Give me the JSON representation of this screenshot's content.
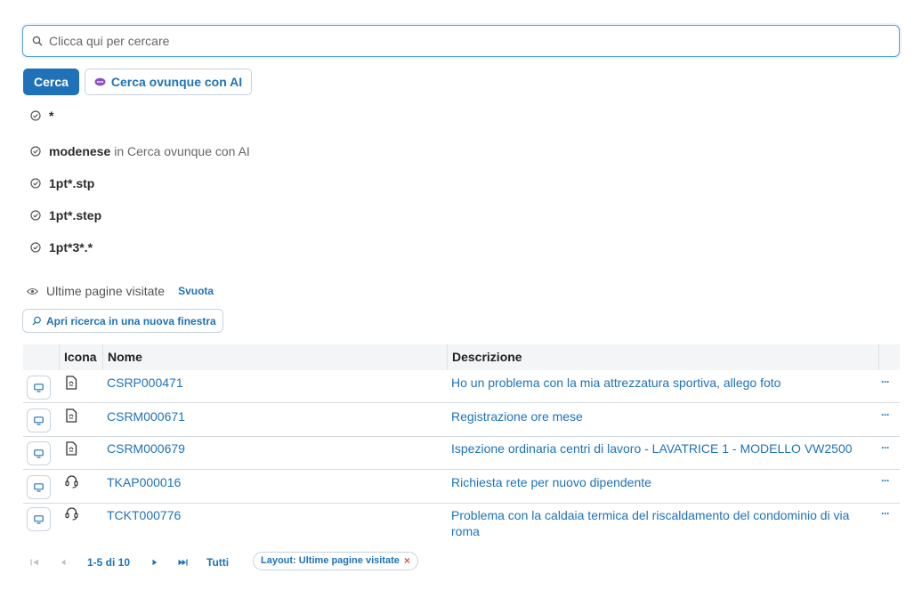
{
  "search": {
    "placeholder": "Clicca qui per cercare",
    "search_button": "Cerca",
    "ai_button": "Cerca ovunque con AI"
  },
  "history": [
    {
      "term": "*",
      "suffix": ""
    },
    {
      "term": "modenese",
      "suffix": "in Cerca ovunque con AI"
    },
    {
      "term": "1pt*.stp",
      "suffix": ""
    },
    {
      "term": "1pt*.step",
      "suffix": ""
    },
    {
      "term": "1pt*3*.*",
      "suffix": ""
    }
  ],
  "recent": {
    "label": "Ultime pagine visitate",
    "clear_link": "Svuota",
    "open_new_window": "Apri ricerca in una nuova finestra"
  },
  "table": {
    "columns": {
      "icon": "Icona",
      "name": "Nome",
      "description": "Descrizione"
    },
    "rows": [
      {
        "icon": "document-icon",
        "name": "CSRP000471",
        "description": "Ho un problema con la mia attrezzatura sportiva, allego foto",
        "more": "···"
      },
      {
        "icon": "document-icon",
        "name": "CSRM000671",
        "description": "Registrazione ore mese",
        "more": "···"
      },
      {
        "icon": "document-icon",
        "name": "CSRM000679",
        "description": "Ispezione ordinaria centri di lavoro - LAVATRICE 1 - MODELLO VW2500",
        "more": "···"
      },
      {
        "icon": "headset-icon",
        "name": "TKAP000016",
        "description": "Richiesta rete per nuovo dipendente",
        "more": "···"
      },
      {
        "icon": "headset-icon",
        "name": "TCKT000776",
        "description": "Problema con la caldaia termica del riscaldamento del condominio di via roma",
        "more": "···"
      }
    ]
  },
  "pager": {
    "range": "1-5 di 10",
    "all": "Tutti",
    "layout_chip": "Layout: Ultime pagine visitate",
    "chip_close": "×"
  },
  "colors": {
    "accent": "#1f72b8",
    "border": "#c9d3dc",
    "focus_border": "#5c9fd6",
    "ai_icon": "#8a4fd1",
    "chip_close": "#d9534f"
  }
}
